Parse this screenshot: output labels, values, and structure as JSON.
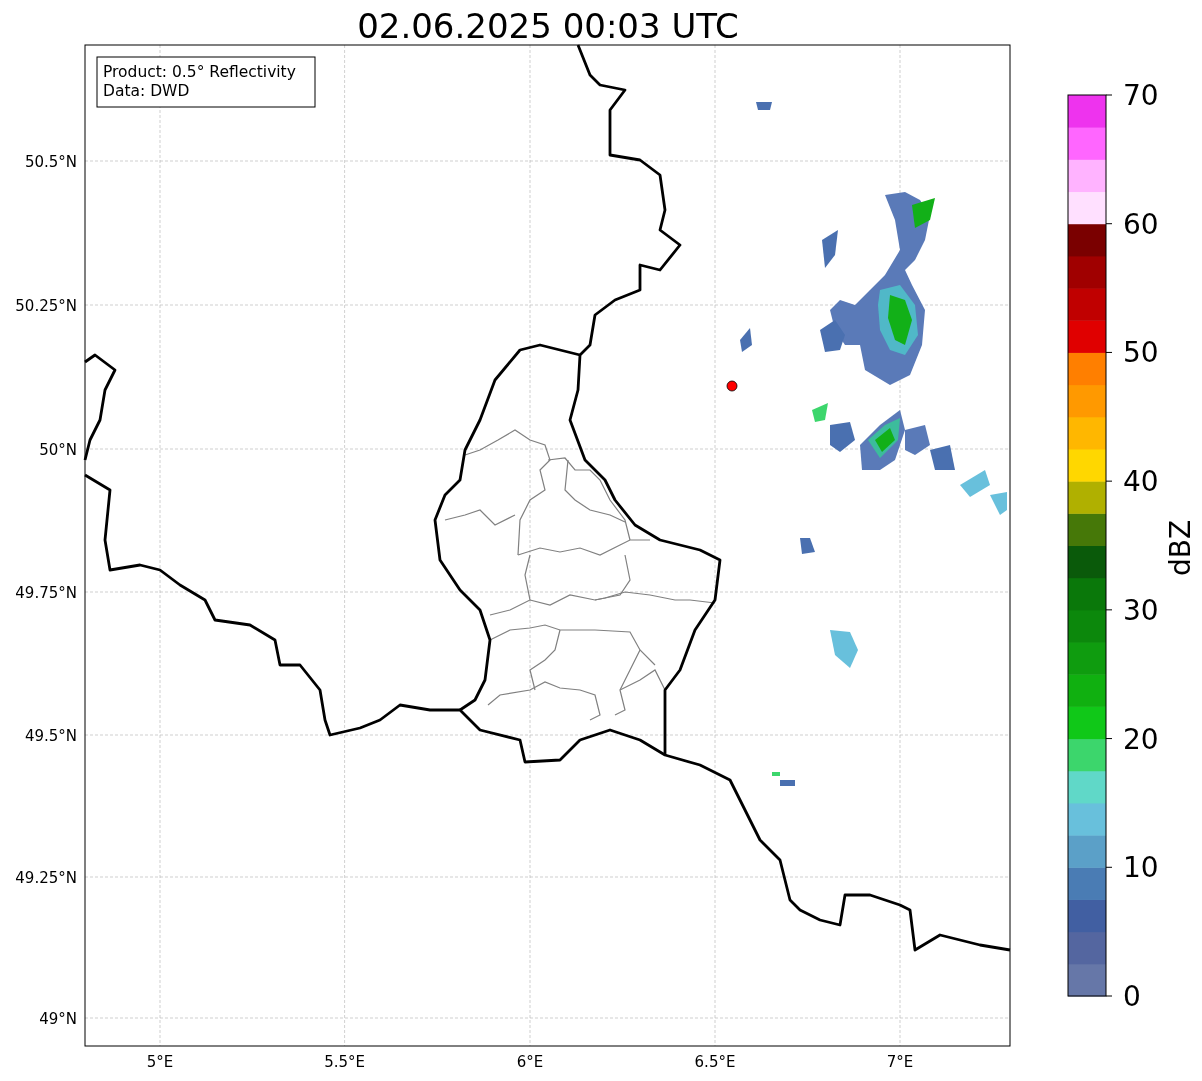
{
  "figure": {
    "title": "02.06.2025 00:03 UTC"
  },
  "map": {
    "legend": [
      "Product: 0.5° Reflectivity",
      "Data: DWD"
    ],
    "lat_ticks": [
      "50.5°N",
      "50.25°N",
      "50°N",
      "49.75°N",
      "49.5°N",
      "49.25°N",
      "49°N"
    ],
    "lon_ticks": [
      "5°E",
      "5.5°E",
      "6°E",
      "6.5°E",
      "7°E"
    ]
  },
  "colorbar": {
    "label": "dBZ",
    "ticks": [
      "70",
      "60",
      "50",
      "40",
      "30",
      "20",
      "10",
      "0"
    ],
    "segments": [
      {
        "color": "#6677a8"
      },
      {
        "color": "#5466a0"
      },
      {
        "color": "#415fa2"
      },
      {
        "color": "#4a7cb4"
      },
      {
        "color": "#5ba0c8"
      },
      {
        "color": "#68c0dc"
      },
      {
        "color": "#60d8c8"
      },
      {
        "color": "#3cd66c"
      },
      {
        "color": "#10c818"
      },
      {
        "color": "#10b010"
      },
      {
        "color": "#0f9c0f"
      },
      {
        "color": "#0c880c"
      },
      {
        "color": "#0a780a"
      },
      {
        "color": "#0a5a0a"
      },
      {
        "color": "#467808"
      },
      {
        "color": "#b0b000"
      },
      {
        "color": "#ffd700"
      },
      {
        "color": "#ffb700"
      },
      {
        "color": "#ff9900"
      },
      {
        "color": "#ff7f00"
      },
      {
        "color": "#e00000"
      },
      {
        "color": "#c00000"
      },
      {
        "color": "#a00000"
      },
      {
        "color": "#7a0000"
      },
      {
        "color": "#ffe0ff"
      },
      {
        "color": "#ffb3ff"
      },
      {
        "color": "#ff66ff"
      },
      {
        "color": "#ee33ee"
      }
    ]
  }
}
